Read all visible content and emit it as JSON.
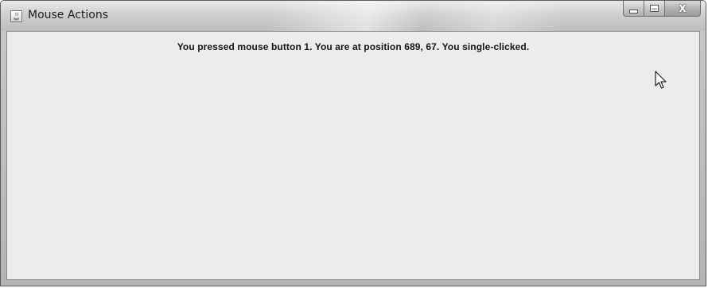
{
  "window": {
    "title": "Mouse Actions",
    "app_icon": "java-coffee-icon",
    "controls": {
      "minimize_icon": "minimize-icon",
      "maximize_icon": "maximize-icon",
      "close_label": "X"
    }
  },
  "content": {
    "status_message": "You pressed mouse button 1. You are at position 689, 67. You single-clicked.",
    "cursor_icon": "mouse-pointer-icon"
  },
  "colors": {
    "client_background": "#ececec",
    "titlebar_top": "#e9e9e9",
    "titlebar_bottom": "#bdbdbd",
    "text": "#151515"
  }
}
